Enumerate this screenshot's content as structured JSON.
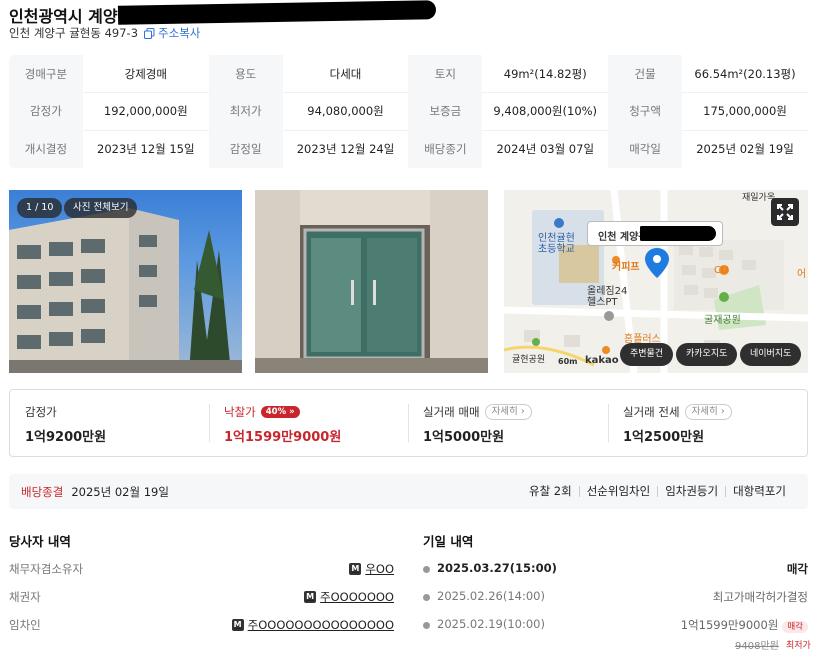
{
  "header": {
    "title": "인천광역시 계양구",
    "address": "인천 계양구 귤현동 497-3",
    "copy_label": "주소복사"
  },
  "info": {
    "rows": [
      [
        {
          "k": "경매구분",
          "v": "강제경매"
        },
        {
          "k": "용도",
          "v": "다세대"
        },
        {
          "k": "토지",
          "v": "49m²(14.82평)"
        },
        {
          "k": "건물",
          "v": "66.54m²(20.13평)"
        }
      ],
      [
        {
          "k": "감정가",
          "v": "192,000,000원"
        },
        {
          "k": "최저가",
          "v": "94,080,000원"
        },
        {
          "k": "보증금",
          "v": "9,408,000원(10%)"
        },
        {
          "k": "청구액",
          "v": "175,000,000원"
        }
      ],
      [
        {
          "k": "개시결정",
          "v": "2023년 12월 15일"
        },
        {
          "k": "감정일",
          "v": "2023년 12월 24일"
        },
        {
          "k": "배당종기",
          "v": "2024년 03월 07일"
        },
        {
          "k": "매각일",
          "v": "2025년 02월 19일"
        }
      ]
    ]
  },
  "photos": {
    "counter": "1 / 10",
    "view_all": "사진 전체보기"
  },
  "map": {
    "popup": "인천 계양구",
    "labels": {
      "school": "인천귤현\n초등학교",
      "cafe": "커피프",
      "gym": "올레짐24\n헬스PT",
      "park": "굴재공원",
      "mart": "홈플러스",
      "cu": "CU",
      "road": "재일가옥",
      "park2": "귤현공원",
      "scale": "60m",
      "brand": "kakao",
      "edge": "어"
    },
    "buttons": [
      "주변물건",
      "카카오지도",
      "네이버지도"
    ]
  },
  "prices": [
    {
      "label": "감정가",
      "value": "1억9200만원",
      "badge": "",
      "detail": ""
    },
    {
      "label": "낙찰가",
      "value": "1억1599만9000원",
      "badge": "40%",
      "detail": ""
    },
    {
      "label": "실거래 매매",
      "value": "1억5000만원",
      "badge": "",
      "detail": "자세히"
    },
    {
      "label": "실거래 전세",
      "value": "1억2500만원",
      "badge": "",
      "detail": "자세히"
    }
  ],
  "status": {
    "state": "배당종결",
    "date": "2025년 02월 19일",
    "tags": [
      "유찰 2회",
      "선순위임차인",
      "임차권등기",
      "대항력포기"
    ]
  },
  "parties": {
    "title": "당사자 내역",
    "rows": [
      {
        "k": "채무자겸소유자",
        "v": "우OO"
      },
      {
        "k": "채권자",
        "v": "주OOOOOOO"
      },
      {
        "k": "임차인",
        "v": "주OOOOOOOOOOOOOOO"
      }
    ],
    "mark": "M"
  },
  "history": {
    "title": "기일 내역",
    "rows": [
      {
        "date": "2025.03.27(15:00)",
        "result": "매각"
      },
      {
        "date": "2025.02.26(14:00)",
        "result": "최고가매각허가결정"
      },
      {
        "date": "2025.02.19(10:00)",
        "result": "1억1599만9000원",
        "tag": "매각"
      }
    ],
    "prev_min": "9408만원",
    "min_label": "최저가"
  }
}
